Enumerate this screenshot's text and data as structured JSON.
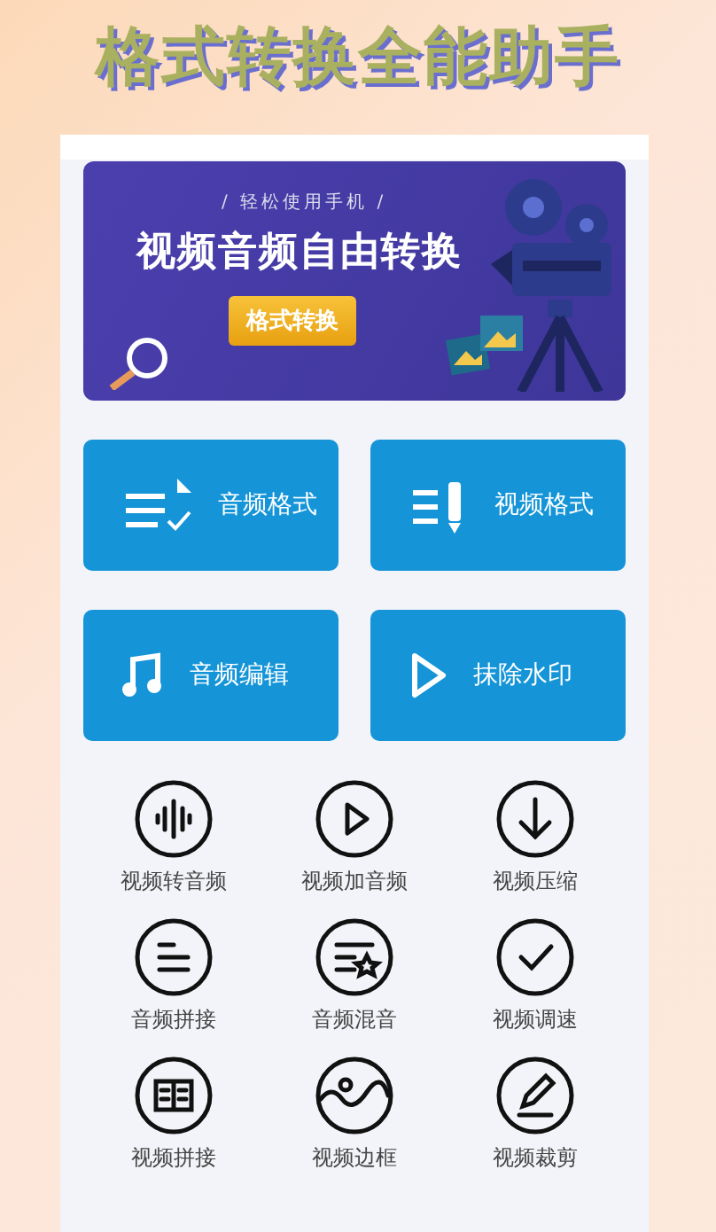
{
  "headline": "格式转换全能助手",
  "banner": {
    "subtitle": "/ 轻松使用手机 /",
    "title": "视频音频自由转换",
    "button": "格式转换"
  },
  "tiles": [
    {
      "label": "音频格式"
    },
    {
      "label": "视频格式"
    },
    {
      "label": "音频编辑"
    },
    {
      "label": "抹除水印"
    }
  ],
  "tools": [
    {
      "label": "视频转音频"
    },
    {
      "label": "视频加音频"
    },
    {
      "label": "视频压缩"
    },
    {
      "label": "音频拼接"
    },
    {
      "label": "音频混音"
    },
    {
      "label": "视频调速"
    },
    {
      "label": "视频拼接"
    },
    {
      "label": "视频边框"
    },
    {
      "label": "视频裁剪"
    }
  ]
}
